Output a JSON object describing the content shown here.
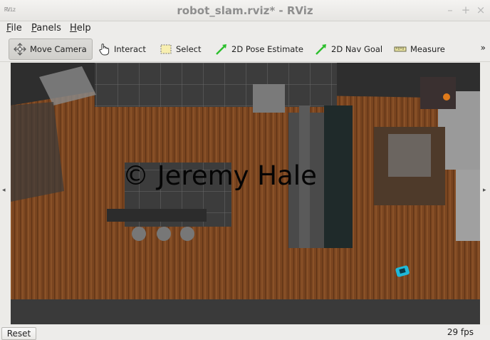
{
  "window": {
    "title": "robot_slam.rviz* - RViz",
    "app_icon_label": "RViz",
    "controls": {
      "minimize": "–",
      "maximize": "+",
      "close": "×"
    }
  },
  "menu": [
    {
      "label": "File",
      "accel": "F",
      "rest": "ile"
    },
    {
      "label": "Panels",
      "accel": "P",
      "rest": "anels"
    },
    {
      "label": "Help",
      "accel": "H",
      "rest": "elp"
    }
  ],
  "toolbar": {
    "tools": [
      {
        "label": "Move Camera",
        "icon": "move-camera-icon",
        "active": true
      },
      {
        "label": "Interact",
        "icon": "hand-pointer-icon",
        "active": false
      },
      {
        "label": "Select",
        "icon": "select-box-icon",
        "active": false
      },
      {
        "label": "2D Pose Estimate",
        "icon": "green-arrow-icon",
        "active": false
      },
      {
        "label": "2D Nav Goal",
        "icon": "green-arrow-icon",
        "active": false
      },
      {
        "label": "Measure",
        "icon": "ruler-icon",
        "active": false
      }
    ],
    "overflow": "»"
  },
  "viewport": {
    "watermark": "© Jeremy Hale",
    "left_arrow": "◂",
    "right_arrow": "▸"
  },
  "status": {
    "reset_label": "Reset",
    "fps": "29 fps"
  },
  "colors": {
    "wood": "#7a4520",
    "floor_dark": "#3a3a3a",
    "wall_grey": "#8a8a8a",
    "robot": "#1fb8d8",
    "accent_green": "#2dbf2d"
  }
}
